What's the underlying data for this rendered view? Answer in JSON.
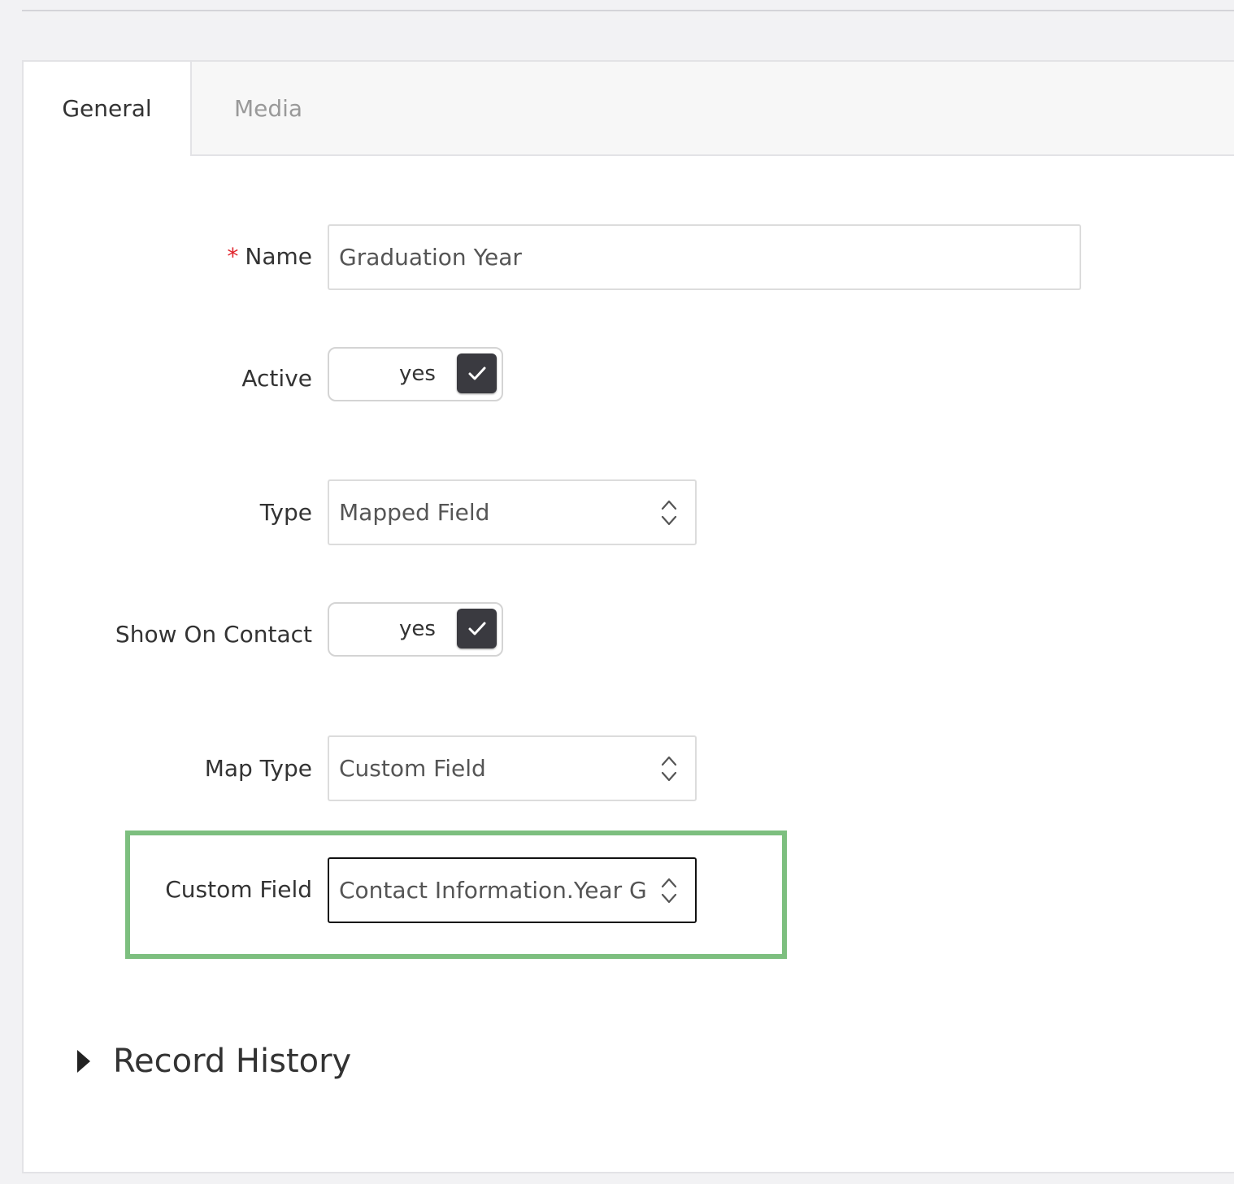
{
  "tabs": [
    {
      "label": "General",
      "active": true
    },
    {
      "label": "Media",
      "active": false
    }
  ],
  "form": {
    "name": {
      "label": "Name",
      "required_mark": "*",
      "value": "Graduation Year"
    },
    "active": {
      "label": "Active",
      "toggle_text": "yes",
      "checked": true
    },
    "type": {
      "label": "Type",
      "value": "Mapped Field"
    },
    "show_on_contact": {
      "label": "Show On Contact",
      "toggle_text": "yes",
      "checked": true
    },
    "map_type": {
      "label": "Map Type",
      "value": "Custom Field"
    },
    "custom_field": {
      "label": "Custom Field",
      "value": "Contact Information.Year Graduated"
    }
  },
  "record_history": {
    "label": "Record History",
    "icon": "caret-right-icon"
  },
  "colors": {
    "highlight": "#7dbf7f",
    "required": "#e0242b",
    "toggle_knob": "#3a3a40"
  }
}
